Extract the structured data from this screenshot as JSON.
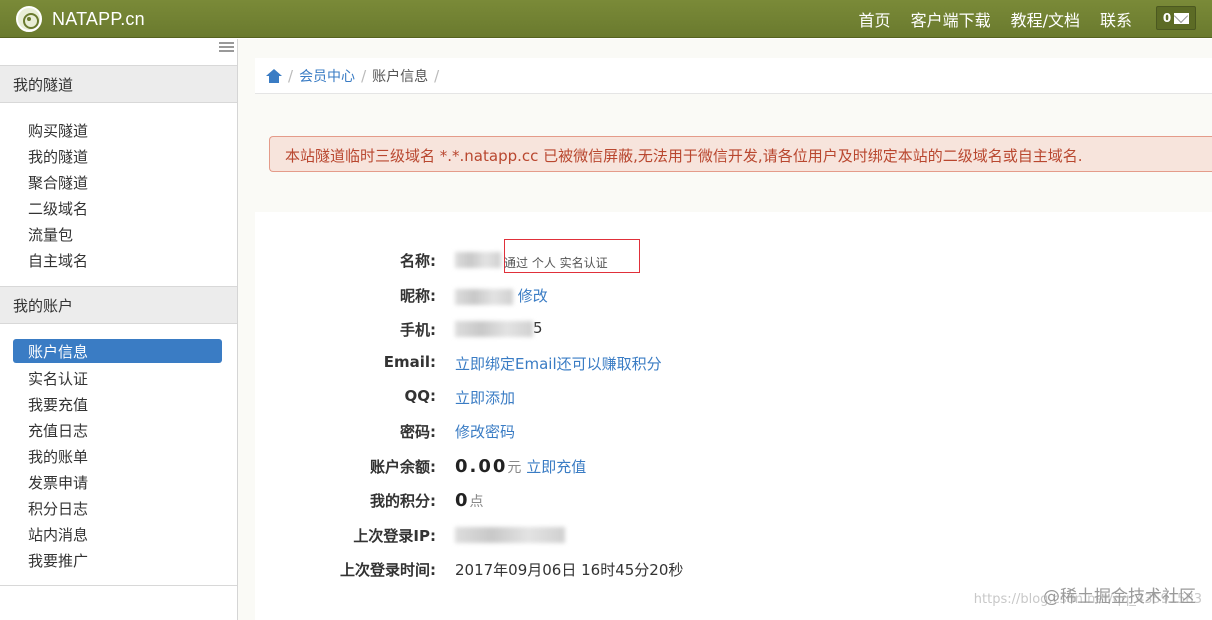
{
  "navbar": {
    "brand": "NATAPP.cn",
    "links": [
      "首页",
      "客户端下载",
      "教程/文档",
      "联系"
    ],
    "message_count": "0"
  },
  "sidebar": {
    "section1": "我的隧道",
    "tunnel_items": [
      "购买隧道",
      "我的隧道",
      "聚合隧道",
      "二级域名",
      "流量包",
      "自主域名"
    ],
    "section2": "我的账户",
    "active_item": "账户信息",
    "account_items": [
      "实名认证",
      "我要充值",
      "充值日志",
      "我的账单",
      "发票申请",
      "积分日志",
      "站内消息",
      "我要推广"
    ]
  },
  "breadcrumb": {
    "items": [
      "会员中心",
      "账户信息"
    ]
  },
  "alert": {
    "text": "本站隧道临时三级域名 *.*.natapp.cc 已被微信屏蔽,无法用于微信开发,请各位用户及时绑定本站的二级域名或自主域名."
  },
  "info": {
    "name_label": "名称:",
    "name_verify": "通过 个人 实名认证",
    "nickname_label": "昵称:",
    "nickname_edit": "修改",
    "phone_label": "手机:",
    "phone_tail": "5",
    "email_label": "Email:",
    "email_link": "立即绑定Email还可以赚取积分",
    "qq_label": "QQ:",
    "qq_link": "立即添加",
    "password_label": "密码:",
    "password_link": "修改密码",
    "balance_label": "账户余额:",
    "balance_value": "0.00",
    "balance_unit": "元",
    "recharge_link": "立即充值",
    "points_label": "我的积分:",
    "points_value": "0",
    "points_unit": "点",
    "last_ip_label": "上次登录IP:",
    "last_time_label": "上次登录时间:",
    "last_time_value": "2017年09月06日 16时45分20秒"
  },
  "watermark": {
    "text": "@稀土掘金技术社区",
    "faint": "https://blog.csdn.net/qq_43591583"
  },
  "colors": {
    "navbar": "#6a7a2e",
    "link": "#3a7cc4",
    "alert_text": "#b9472f",
    "alert_bg": "#f7e4dc"
  }
}
